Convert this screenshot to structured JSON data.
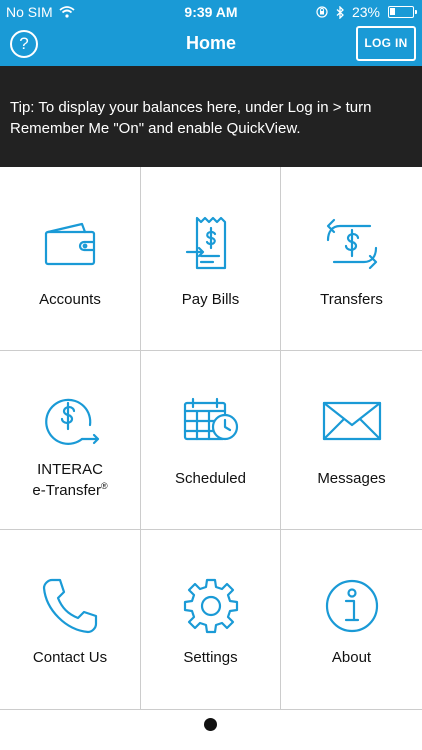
{
  "status_bar": {
    "carrier": "No SIM",
    "time": "9:39 AM",
    "battery": "23%",
    "battery_level": 0.23
  },
  "navbar": {
    "help_label": "?",
    "title": "Home",
    "login_label": "LOG IN"
  },
  "tip": {
    "text": "Tip: To display your balances here, under Log in > turn Remember Me \"On\" and enable QuickView."
  },
  "tiles": [
    {
      "label": "Accounts",
      "icon": "wallet-icon"
    },
    {
      "label": "Pay Bills",
      "icon": "bill-icon"
    },
    {
      "label": "Transfers",
      "icon": "transfer-icon"
    },
    {
      "label_line1": "INTERAC",
      "label_line2": "e-Transfer",
      "label_sup": "®",
      "icon": "etransfer-icon"
    },
    {
      "label": "Scheduled",
      "icon": "calendar-clock-icon"
    },
    {
      "label": "Messages",
      "icon": "envelope-icon"
    },
    {
      "label": "Contact Us",
      "icon": "phone-icon"
    },
    {
      "label": "Settings",
      "icon": "gear-icon"
    },
    {
      "label": "About",
      "icon": "info-icon"
    }
  ],
  "colors": {
    "brand": "#1a9ad6",
    "tip_bg": "#222222"
  }
}
